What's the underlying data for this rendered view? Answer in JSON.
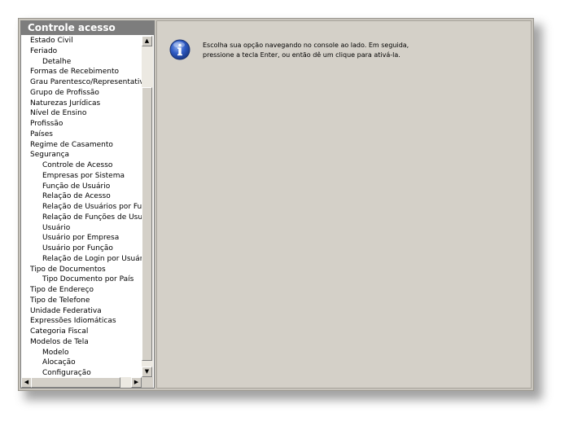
{
  "panel": {
    "title": "Controle acesso",
    "items": [
      {
        "label": "Estado Civil",
        "level": 0
      },
      {
        "label": "Feriado",
        "level": 0
      },
      {
        "label": "Detalhe",
        "level": 1
      },
      {
        "label": "Formas de Recebimento",
        "level": 0
      },
      {
        "label": "Grau Parentesco/Representatividade",
        "level": 0
      },
      {
        "label": "Grupo de Profissão",
        "level": 0
      },
      {
        "label": "Naturezas Jurídicas",
        "level": 0
      },
      {
        "label": "Nível de Ensino",
        "level": 0
      },
      {
        "label": "Profissão",
        "level": 0
      },
      {
        "label": "Países",
        "level": 0
      },
      {
        "label": "Regime de Casamento",
        "level": 0
      },
      {
        "label": "Segurança",
        "level": 0
      },
      {
        "label": "Controle de Acesso",
        "level": 1
      },
      {
        "label": "Empresas por Sistema",
        "level": 1
      },
      {
        "label": "Função de Usuário",
        "level": 1
      },
      {
        "label": "Relação de Acesso",
        "level": 1
      },
      {
        "label": "Relação de Usuários por Função",
        "level": 1
      },
      {
        "label": "Relação de Funções de Usuários",
        "level": 1
      },
      {
        "label": "Usuário",
        "level": 1
      },
      {
        "label": "Usuário por Empresa",
        "level": 1
      },
      {
        "label": "Usuário por Função",
        "level": 1
      },
      {
        "label": "Relação de Login por Usuário",
        "level": 1
      },
      {
        "label": "Tipo de Documentos",
        "level": 0
      },
      {
        "label": "Tipo Documento por País",
        "level": 1
      },
      {
        "label": "Tipo de Endereço",
        "level": 0
      },
      {
        "label": "Tipo de Telefone",
        "level": 0
      },
      {
        "label": "Unidade Federativa",
        "level": 0
      },
      {
        "label": "Expressões Idiomáticas",
        "level": 0
      },
      {
        "label": "Categoria Fiscal",
        "level": 0
      },
      {
        "label": "Modelos de Tela",
        "level": 0
      },
      {
        "label": "Modelo",
        "level": 1
      },
      {
        "label": "Alocação",
        "level": 1
      },
      {
        "label": "Configuração",
        "level": 1
      }
    ]
  },
  "content": {
    "icon": "info-icon",
    "message_line1": "Escolha sua opção navegando no console ao lado. Em seguida,",
    "message_line2": "pressione a tecla Enter, ou então dê um clique para ativá-la."
  },
  "colors": {
    "header_bg": "#7d7d7d",
    "info_icon": "#2a4fb8"
  }
}
